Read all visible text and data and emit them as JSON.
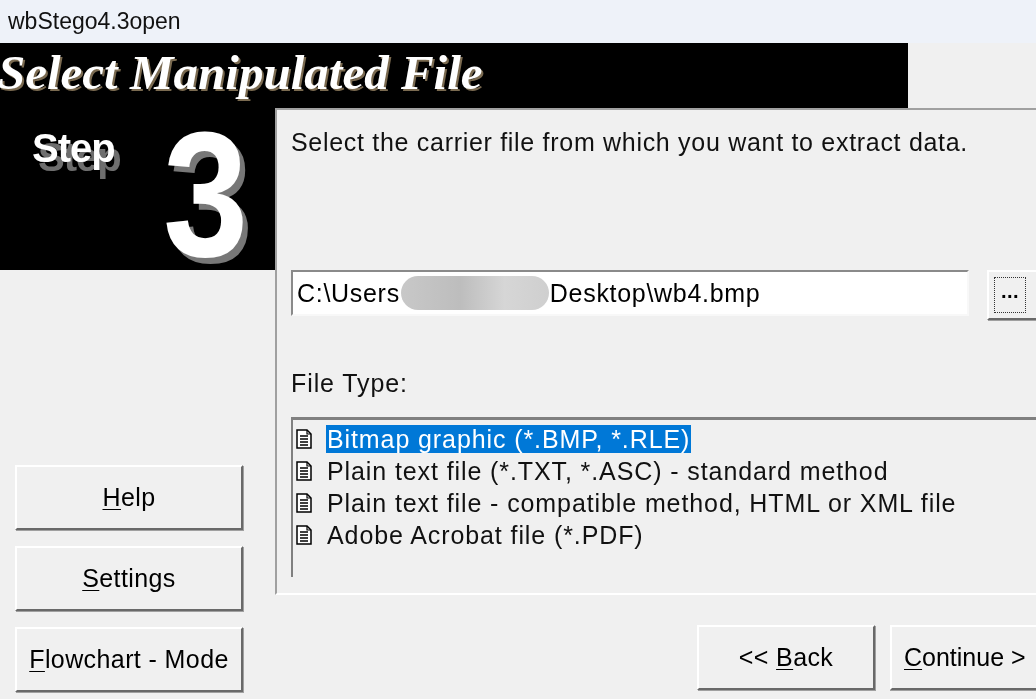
{
  "window": {
    "title": "wbStego4.3open"
  },
  "header": {
    "title": "Select Manipulated File",
    "step_label": "Step",
    "step_number": "3"
  },
  "instruction": "Select the carrier file from which you want to extract data.",
  "path_field": {
    "value_start": "C:\\Users",
    "value_end": "Desktop\\wb4.bmp",
    "browse_button": "..."
  },
  "file_type": {
    "label": "File Type:",
    "items": [
      {
        "label": "Bitmap graphic (*.BMP, *.RLE)",
        "selected": true
      },
      {
        "label": "Plain text file (*.TXT, *.ASC) - standard method",
        "selected": false
      },
      {
        "label": "Plain text file - compatible method, HTML or XML file",
        "selected": false
      },
      {
        "label": "Adobe Acrobat file (*.PDF)",
        "selected": false
      }
    ]
  },
  "side_buttons": [
    {
      "mnemonic": "H",
      "rest": "elp"
    },
    {
      "mnemonic": "S",
      "rest": "ettings"
    },
    {
      "mnemonic": "F",
      "rest": "lowchart - Mode"
    }
  ],
  "nav_buttons": [
    {
      "prefix": "<< ",
      "mnemonic": "B",
      "rest": "ack"
    },
    {
      "mnemonic": "C",
      "rest": "ontinue >"
    }
  ]
}
